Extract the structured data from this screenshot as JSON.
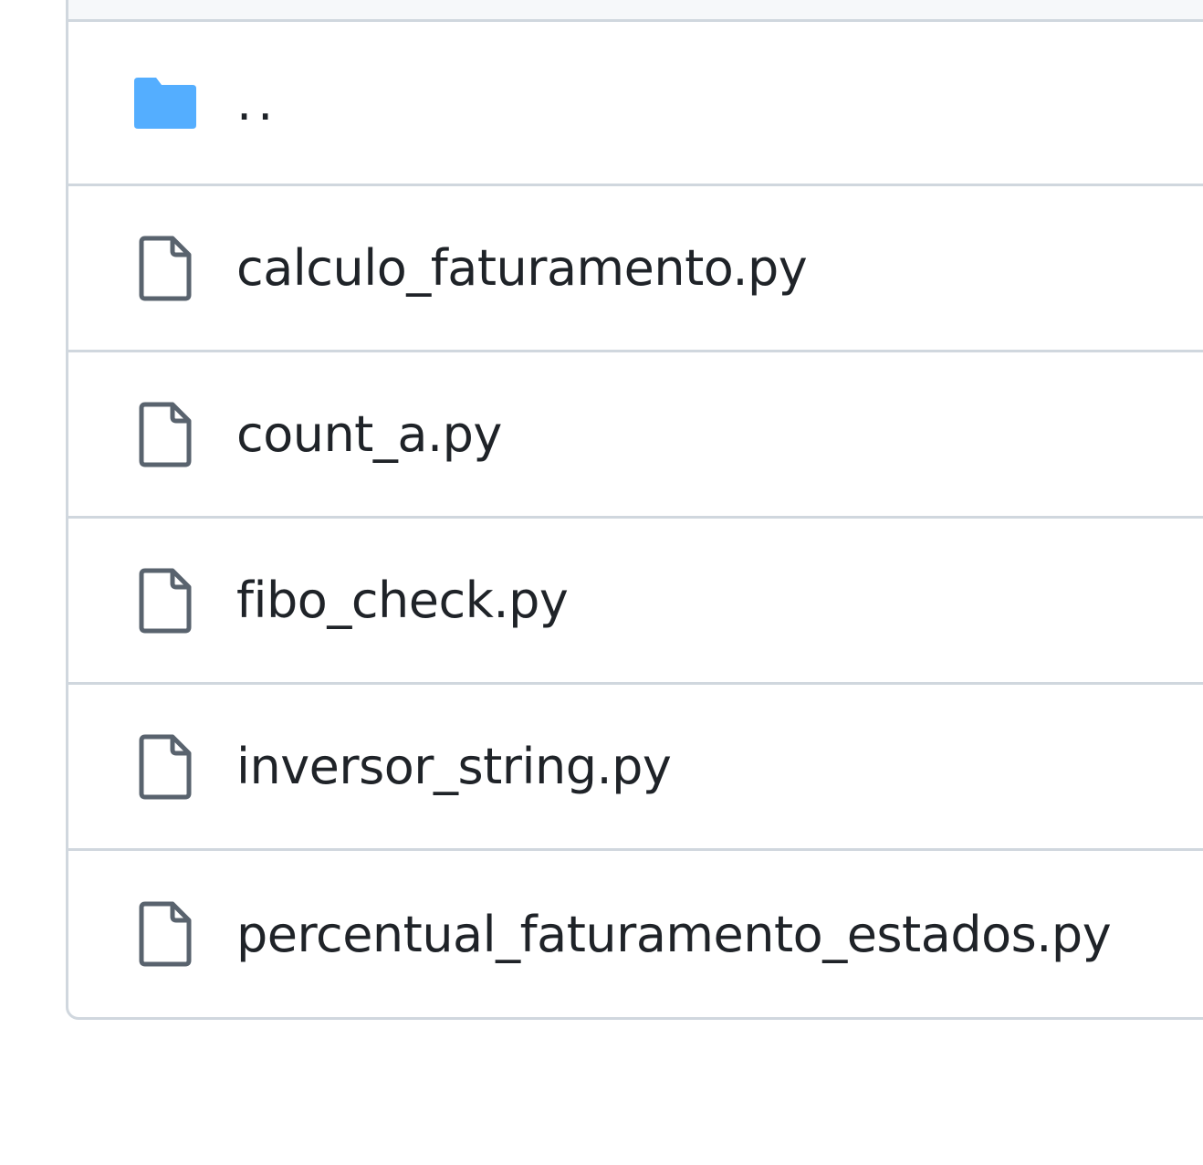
{
  "file_browser": {
    "parent_entry": {
      "label": "..",
      "icon": "folder-icon",
      "icon_color": "#54aeff"
    },
    "files": [
      {
        "name": "calculo_faturamento.py",
        "icon": "file-icon"
      },
      {
        "name": "count_a.py",
        "icon": "file-icon"
      },
      {
        "name": "fibo_check.py",
        "icon": "file-icon"
      },
      {
        "name": "inversor_string.py",
        "icon": "file-icon"
      },
      {
        "name": "percentual_faturamento_estados.py",
        "icon": "file-icon"
      }
    ],
    "colors": {
      "border": "#d0d7de",
      "text": "#1f2328",
      "file_icon_stroke": "#59636e",
      "header_bg": "#f6f8fa"
    }
  }
}
